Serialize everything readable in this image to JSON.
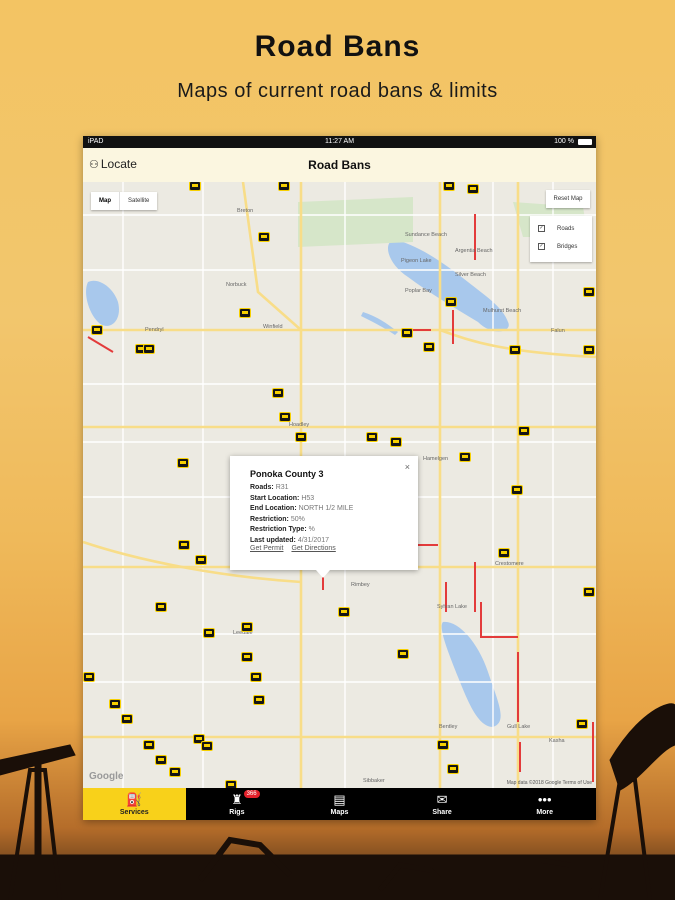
{
  "promo": {
    "title": "Road Bans",
    "subtitle": "Maps of current road bans & limits"
  },
  "statusbar": {
    "carrier": "iPAD",
    "time": "11:27 AM",
    "battery": "100 %"
  },
  "navbar": {
    "locate_label": "Locate",
    "title": "Road Bans"
  },
  "map": {
    "maptype_options": [
      "Map",
      "Satellite"
    ],
    "maptype_selected": "Map",
    "reset_label": "Reset Map",
    "layers": [
      {
        "label": "Roads",
        "checked": true
      },
      {
        "label": "Bridges",
        "checked": true
      }
    ],
    "towns": [
      "Breton",
      "Sundance Beach",
      "Argentia Beach",
      "Silver Beach",
      "Pigeon Lake",
      "Norbuck",
      "Poplar Bay",
      "Mulhurst Beach",
      "Winfield",
      "Pendryl",
      "Falun",
      "Hoadley",
      "Hamelgen",
      "Crestomere",
      "Rimbey",
      "Sylvan Lake",
      "Leedale",
      "Bentley",
      "Gull Lake",
      "Kasha",
      "Sibbaker"
    ],
    "google_label": "Google",
    "attribution": "Map data ©2018 Google   Terms of Use"
  },
  "popup": {
    "title": "Ponoka County 3",
    "fields": [
      {
        "label": "Roads:",
        "value": "R31"
      },
      {
        "label": "Start Location:",
        "value": "H53"
      },
      {
        "label": "End Location:",
        "value": "NORTH 1/2 MILE"
      },
      {
        "label": "Restriction:",
        "value": "50%"
      },
      {
        "label": "Restriction Type:",
        "value": "%"
      },
      {
        "label": "Last updated:",
        "value": "4/31/2017"
      }
    ],
    "link_permit": "Get Permit",
    "link_directions": "Get Directions",
    "close_glyph": "×"
  },
  "tabs": [
    {
      "label": "Services",
      "icon": "oil-pump-icon",
      "glyph": "⛽",
      "selected": true
    },
    {
      "label": "Rigs",
      "icon": "rig-icon",
      "glyph": "♜",
      "badge": "366"
    },
    {
      "label": "Maps",
      "icon": "document-icon",
      "glyph": "▤"
    },
    {
      "label": "Share",
      "icon": "share-icon",
      "glyph": "✉"
    },
    {
      "label": "More",
      "icon": "more-icon",
      "glyph": "•••"
    }
  ],
  "colors": {
    "accent_yellow": "#f8d11a",
    "road_ban_red": "#e33b3b",
    "water_blue": "#a8c8ec",
    "highway_yellow": "#f8dd88"
  }
}
